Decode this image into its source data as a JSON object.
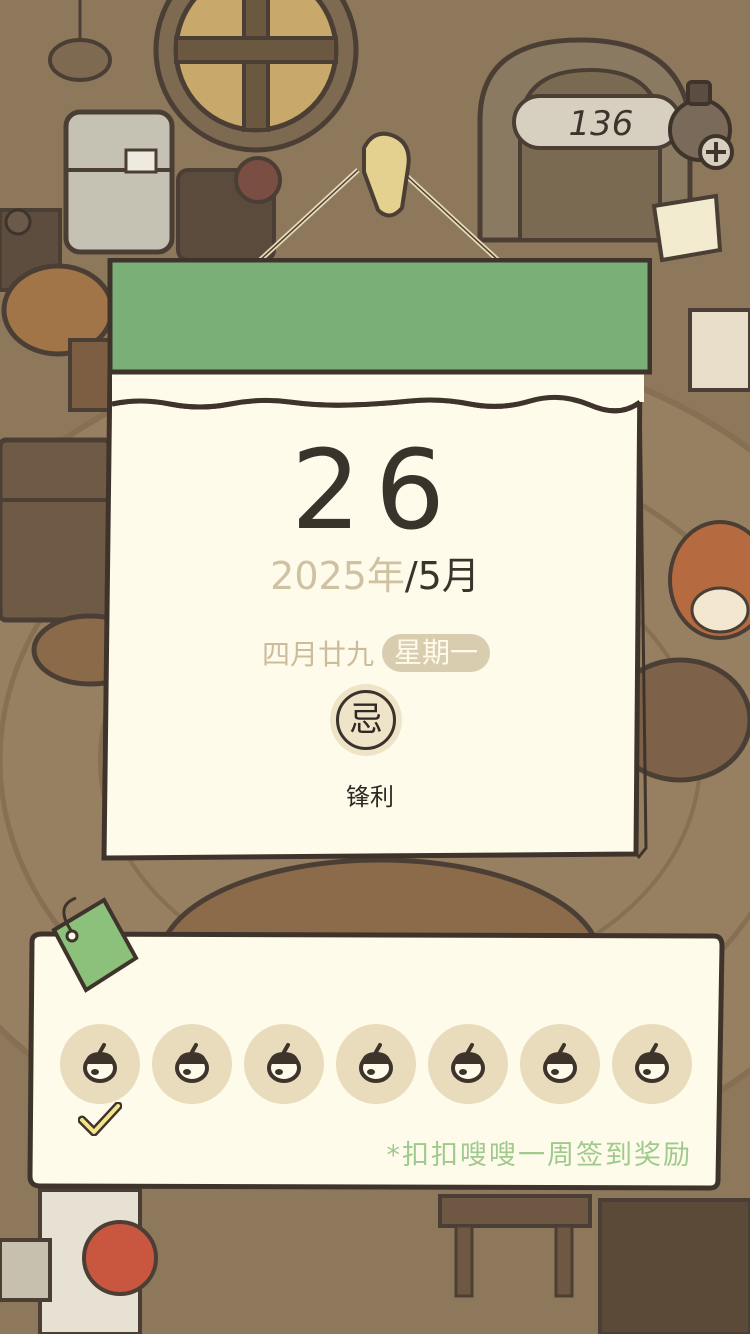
{
  "hud": {
    "coin_count": "136",
    "add_icon": "plus-icon"
  },
  "calendar": {
    "day": "26",
    "year": "2025年",
    "month": "/5月",
    "lunar_date": "四月廿九",
    "weekday": "星期一",
    "ji_label": "忌",
    "ji_item": "锋利"
  },
  "signin": {
    "caption": "*扣扣嗖嗖一周签到奖励",
    "days": [
      {
        "icon": "acorn-icon",
        "checked": true
      },
      {
        "icon": "acorn-icon",
        "checked": false
      },
      {
        "icon": "acorn-icon",
        "checked": false
      },
      {
        "icon": "acorn-icon",
        "checked": false
      },
      {
        "icon": "acorn-icon",
        "checked": false
      },
      {
        "icon": "acorn-icon",
        "checked": false
      },
      {
        "icon": "acorn-icon",
        "checked": false
      }
    ]
  },
  "colors": {
    "header_green": "#7ab078",
    "paper": "#fffbea",
    "outline": "#4b3f35",
    "caption_green": "#9fca8e",
    "slot": "#e9dcbc"
  }
}
